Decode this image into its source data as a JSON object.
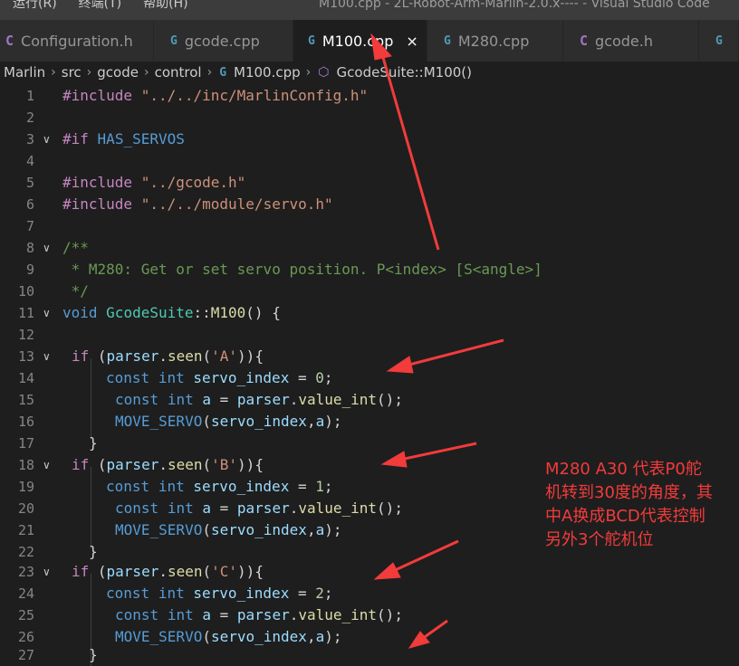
{
  "window": {
    "menu": [
      "运行(R)",
      "终端(T)",
      "帮助(H)"
    ],
    "title": "M100.cpp - 2L-Robot-Arm-Marlin-2.0.x---- - Visual Studio Code"
  },
  "tabs": [
    {
      "icon": "C",
      "label": "Configuration.h"
    },
    {
      "icon": "G",
      "label": "gcode.cpp"
    },
    {
      "icon": "G",
      "label": "M100.cpp",
      "close": "×"
    },
    {
      "icon": "G",
      "label": "M280.cpp"
    },
    {
      "icon": "C",
      "label": "gcode.h"
    },
    {
      "icon": "G",
      "label": ""
    }
  ],
  "breadcrumb": {
    "items": [
      "Marlin",
      "src",
      "gcode",
      "control",
      "M100.cpp",
      "GcodeSuite::M100()"
    ]
  },
  "code": {
    "line_numbers": [
      "1",
      "2",
      "3",
      "4",
      "5",
      "6",
      "7",
      "8",
      "9",
      "10",
      "11",
      "12",
      "13",
      "14",
      "15",
      "16",
      "17",
      "18",
      "19",
      "20",
      "21",
      "22",
      "23",
      "24",
      "25",
      "26",
      "27"
    ],
    "line1_include": "#include",
    "line1_path": "\"../../inc/MarlinConfig.h\"",
    "line3_if": "#if",
    "line3_cond": "HAS_SERVOS",
    "line5_include": "#include",
    "line5_path": "\"../gcode.h\"",
    "line6_include": "#include",
    "line6_path": "\"../../module/servo.h\"",
    "line8_comment": "/**",
    "line9_comment": " * M280: Get or set servo position. P<index> [S<angle>]",
    "line10_comment": " */",
    "line11_void": "void",
    "line11_class": "GcodeSuite",
    "line11_scope": "::",
    "line11_fn": "M100",
    "line11_rest": "() {",
    "if_keyword": "if",
    "parser": "parser",
    "seen": "seen",
    "const": "const",
    "int": "int",
    "servo_index": "servo_index",
    "a": "a",
    "value_int": "value_int",
    "move_servo": "MOVE_SERVO",
    "char_a": "'A'",
    "char_b": "'B'",
    "char_c": "'C'",
    "idx0": "0",
    "idx1": "1",
    "idx2": "2"
  },
  "annotation": {
    "lines": [
      "M280 A30  代表P0舵",
      "机转到30度的角度，其",
      "中A换成BCD代表控制",
      "另外3个舵机位"
    ],
    "color": "#f23b3b"
  },
  "colors": {
    "editor_bg": "#1e1e1e",
    "tab_active": "#1e1e1e",
    "tab_inactive": "#2d2d2d",
    "arrow": "#f23b3b"
  }
}
